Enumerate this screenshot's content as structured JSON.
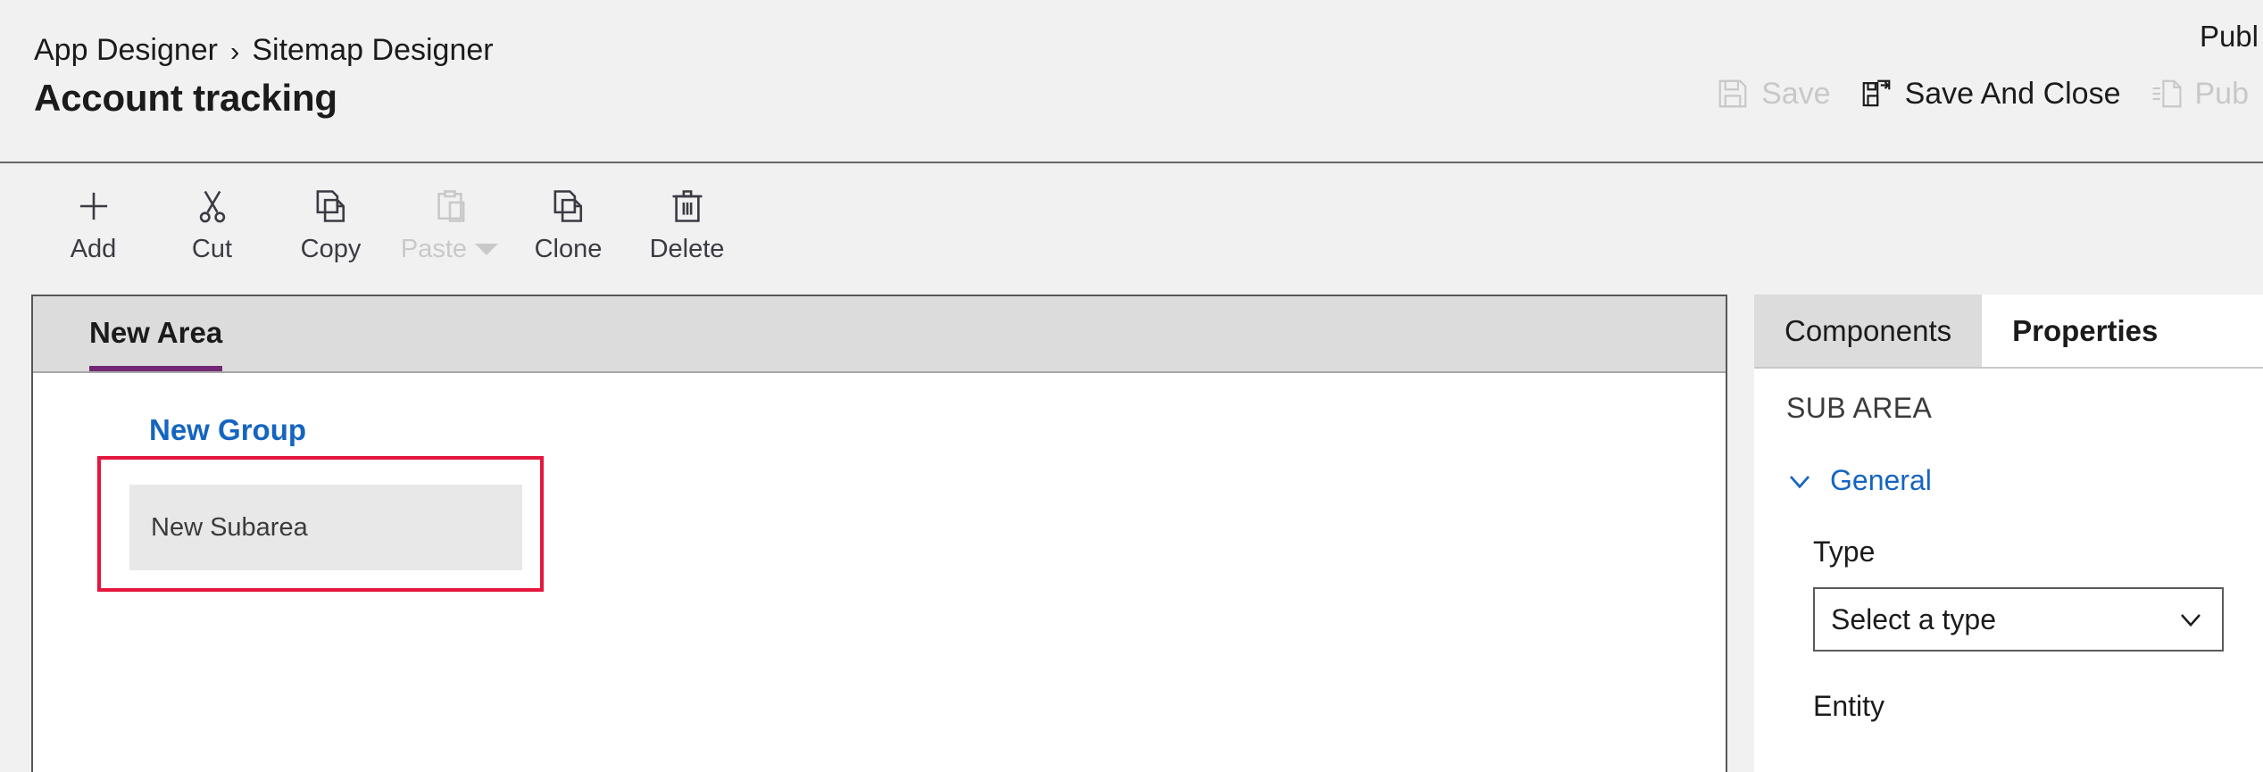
{
  "header": {
    "breadcrumb": {
      "items": [
        "App Designer",
        "Sitemap Designer"
      ],
      "separator": "›"
    },
    "title": "Account tracking",
    "top_note": "Publ",
    "commands": [
      {
        "label": "Save",
        "icon": "save-icon",
        "disabled": true
      },
      {
        "label": "Save And Close",
        "icon": "save-and-close-icon",
        "disabled": false
      },
      {
        "label": "Pub",
        "icon": "publish-icon",
        "disabled": true
      }
    ]
  },
  "toolbar": {
    "buttons": [
      {
        "label": "Add",
        "icon": "plus-icon",
        "disabled": false,
        "has_caret": false
      },
      {
        "label": "Cut",
        "icon": "scissors-icon",
        "disabled": false,
        "has_caret": false
      },
      {
        "label": "Copy",
        "icon": "copy-icon",
        "disabled": false,
        "has_caret": false
      },
      {
        "label": "Paste",
        "icon": "clipboard-icon",
        "disabled": true,
        "has_caret": true
      },
      {
        "label": "Clone",
        "icon": "clone-icon",
        "disabled": false,
        "has_caret": false
      },
      {
        "label": "Delete",
        "icon": "trash-icon",
        "disabled": false,
        "has_caret": false
      }
    ]
  },
  "canvas": {
    "area_tab": "New Area",
    "group_label": "New Group",
    "subarea_label": "New Subarea",
    "selection_color": "#e3173e",
    "accent_underline_color": "#742774",
    "group_link_color": "#1565c0"
  },
  "properties": {
    "tabs": [
      {
        "label": "Components",
        "active": false
      },
      {
        "label": "Properties",
        "active": true
      }
    ],
    "section_title": "SUB AREA",
    "general_label": "General",
    "fields": [
      {
        "label": "Type",
        "value": "Select a type",
        "control": "select"
      },
      {
        "label": "Entity",
        "value": "",
        "control": "select"
      }
    ]
  }
}
